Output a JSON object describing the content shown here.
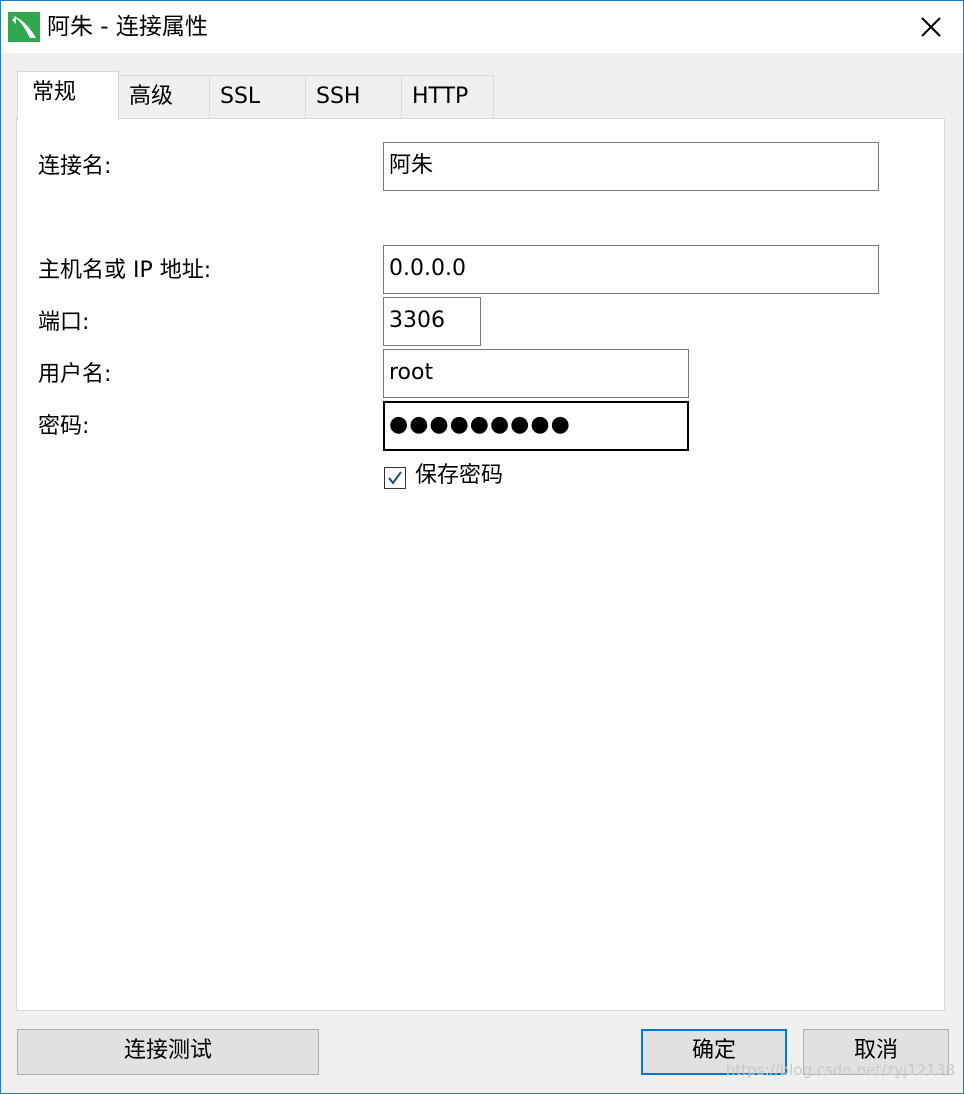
{
  "window": {
    "title": "阿朱 - 连接属性"
  },
  "icons": {
    "app": "navicat-mysql-icon",
    "close": "close-icon",
    "check": "checkmark-icon"
  },
  "tabs": [
    {
      "label": "常规",
      "active": true
    },
    {
      "label": "高级",
      "active": false
    },
    {
      "label": "SSL",
      "active": false
    },
    {
      "label": "SSH",
      "active": false
    },
    {
      "label": "HTTP",
      "active": false
    }
  ],
  "form": {
    "connection_name": {
      "label": "连接名:",
      "value": "阿朱"
    },
    "host": {
      "label": "主机名或 IP 地址:",
      "value": "0.0.0.0"
    },
    "port": {
      "label": "端口:",
      "value": "3306"
    },
    "username": {
      "label": "用户名:",
      "value": "root"
    },
    "password": {
      "label": "密码:",
      "value": "●●●●●●●●●"
    },
    "save_password": {
      "label": "保存密码",
      "checked": true
    }
  },
  "buttons": {
    "test": "连接测试",
    "ok": "确定",
    "cancel": "取消"
  },
  "watermark": "https://blog.csdn.net/zyj12138",
  "colors": {
    "accent": "#0078d7",
    "icon_green": "#2fa84f"
  }
}
